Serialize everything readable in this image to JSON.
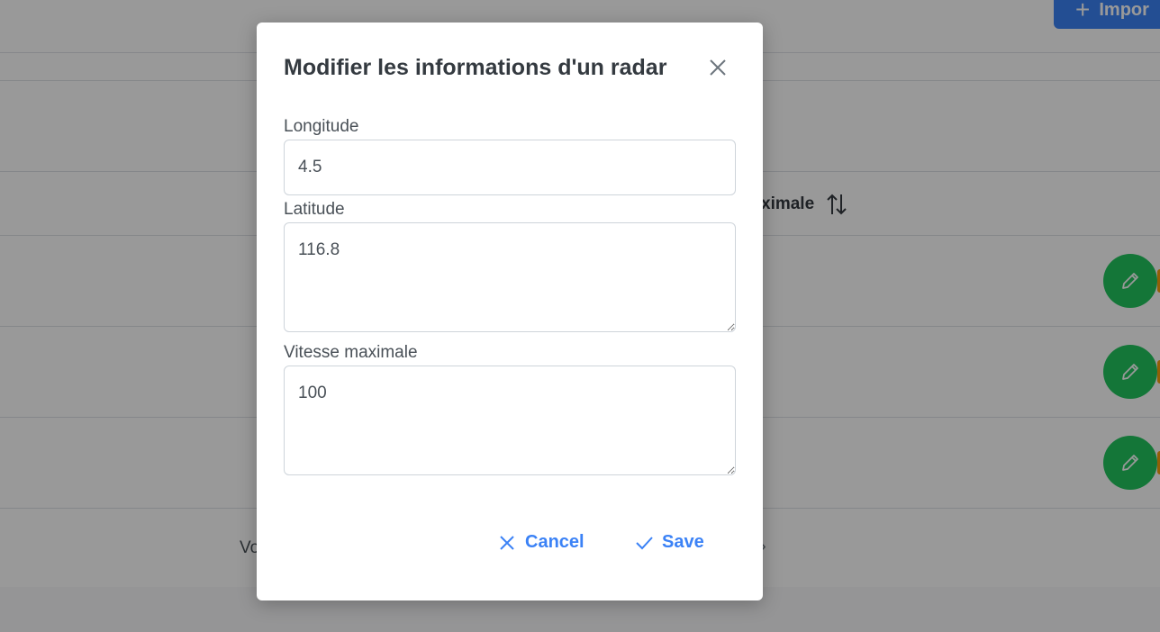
{
  "background": {
    "import_button_label": "Impor",
    "column_header": "ximale",
    "footer_text": "Vo",
    "footer_chevron": "›"
  },
  "dialog": {
    "title": "Modifier les informations d'un radar",
    "fields": {
      "longitude": {
        "label": "Longitude",
        "value": "4.5"
      },
      "latitude": {
        "label": "Latitude",
        "value": "116.8"
      },
      "vitesse": {
        "label": "Vitesse maximale",
        "value": "100"
      }
    },
    "cancel_label": "Cancel",
    "save_label": "Save"
  },
  "colors": {
    "primary": "#3B82F6",
    "success": "#22C55E",
    "warning": "#F59E0B",
    "overlay": "rgba(0,0,0,0.4)"
  },
  "icons": [
    "close-icon",
    "plus-icon",
    "sort-icon",
    "pencil-icon",
    "times-icon",
    "check-icon"
  ]
}
